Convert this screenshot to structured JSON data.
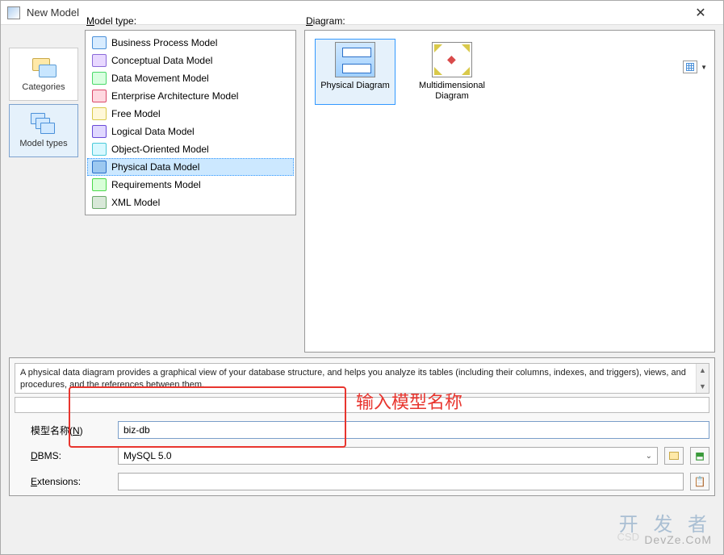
{
  "window": {
    "title": "New Model"
  },
  "sidebar": {
    "items": [
      {
        "label": "Categories"
      },
      {
        "label": "Model types"
      }
    ],
    "active": 1
  },
  "model_type": {
    "header_prefix": "M",
    "header_rest": "odel type:",
    "items": [
      {
        "label": "Business Process Model",
        "cls": "bpm"
      },
      {
        "label": "Conceptual Data Model",
        "cls": "cdm"
      },
      {
        "label": "Data Movement Model",
        "cls": "dmm"
      },
      {
        "label": "Enterprise Architecture Model",
        "cls": "eam"
      },
      {
        "label": "Free Model",
        "cls": "free"
      },
      {
        "label": "Logical Data Model",
        "cls": "ldm"
      },
      {
        "label": "Object-Oriented Model",
        "cls": "oom"
      },
      {
        "label": "Physical Data Model",
        "cls": "pdm"
      },
      {
        "label": "Requirements Model",
        "cls": "rqm"
      },
      {
        "label": "XML Model",
        "cls": "xml"
      }
    ],
    "selected": 7
  },
  "diagram": {
    "header_prefix": "D",
    "header_rest": "iagram:",
    "items": [
      {
        "label": "Physical Diagram",
        "cls": "pd"
      },
      {
        "label": "Multidimensional Diagram",
        "cls": "md"
      }
    ],
    "selected": 0
  },
  "description": "A physical data diagram provides a graphical view of your database structure, and helps you analyze its tables (including their columns, indexes, and triggers), views, and procedures, and the references between them.",
  "form": {
    "name_label": "模型名称(",
    "name_accel": "N",
    "name_label_end": ")",
    "name_value": "biz-db",
    "dbms_label_prefix": "D",
    "dbms_label_rest": "BMS:",
    "dbms_value": "MySQL 5.0",
    "ext_label_prefix": "E",
    "ext_label_rest": "xtensions:",
    "ext_value": ""
  },
  "annotation": {
    "text": "输入模型名称"
  },
  "watermark": {
    "line1": "开 发 者",
    "line2": "DevZe.CoM",
    "csdn": "CSD"
  }
}
